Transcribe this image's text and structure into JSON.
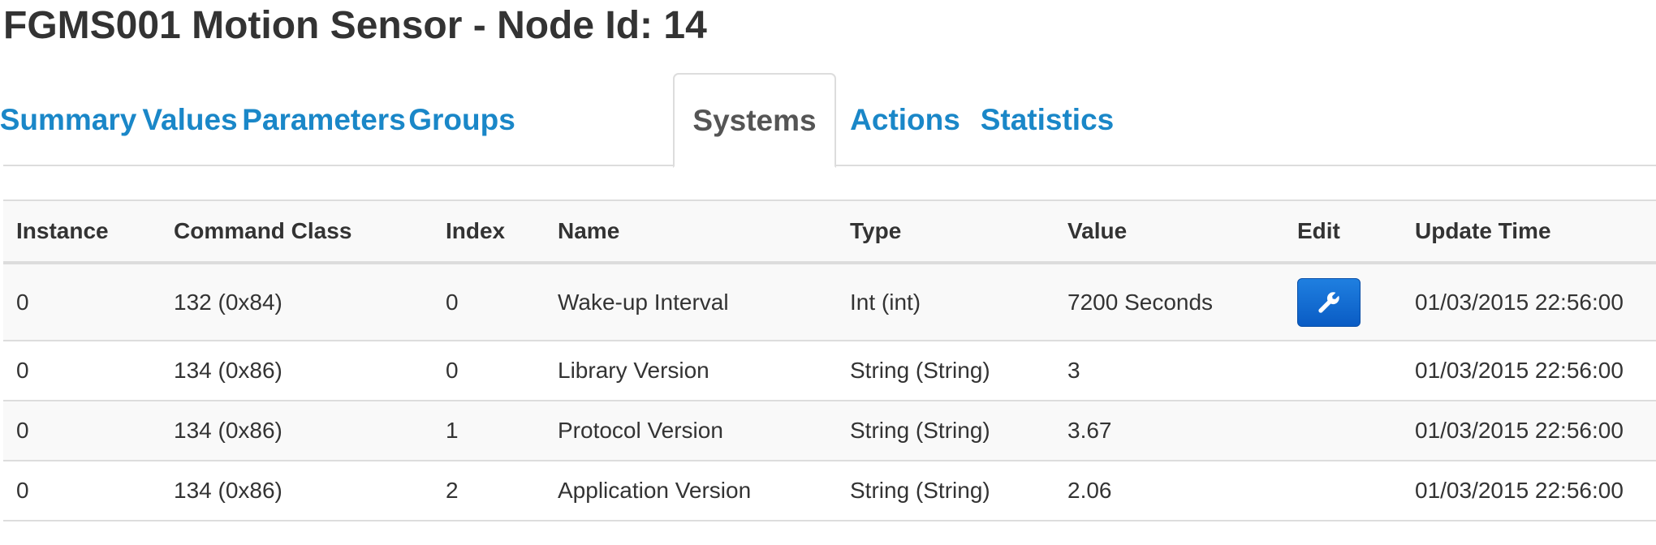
{
  "page": {
    "title": "FGMS001 Motion Sensor - Node Id: 14"
  },
  "tabs": [
    {
      "label": "Summary",
      "active": false
    },
    {
      "label": "Values",
      "active": false
    },
    {
      "label": "Parameters",
      "active": false
    },
    {
      "label": "Groups",
      "active": false
    },
    {
      "label": "Systems",
      "active": true
    },
    {
      "label": "Actions",
      "active": false
    },
    {
      "label": "Statistics",
      "active": false
    }
  ],
  "table": {
    "headers": {
      "instance": "Instance",
      "command_class": "Command Class",
      "index": "Index",
      "name": "Name",
      "type": "Type",
      "value": "Value",
      "edit": "Edit",
      "update_time": "Update Time"
    },
    "rows": [
      {
        "instance": "0",
        "command_class": "132 (0x84)",
        "index": "0",
        "name": "Wake-up Interval",
        "type": "Int (int)",
        "value": "7200 Seconds",
        "editable": true,
        "update_time": "01/03/2015 22:56:00"
      },
      {
        "instance": "0",
        "command_class": "134 (0x86)",
        "index": "0",
        "name": "Library Version",
        "type": "String (String)",
        "value": "3",
        "editable": false,
        "update_time": "01/03/2015 22:56:00"
      },
      {
        "instance": "0",
        "command_class": "134 (0x86)",
        "index": "1",
        "name": "Protocol Version",
        "type": "String (String)",
        "value": "3.67",
        "editable": false,
        "update_time": "01/03/2015 22:56:00"
      },
      {
        "instance": "0",
        "command_class": "134 (0x86)",
        "index": "2",
        "name": "Application Version",
        "type": "String (String)",
        "value": "2.06",
        "editable": false,
        "update_time": "01/03/2015 22:56:00"
      }
    ]
  },
  "icons": {
    "edit": "wrench-icon"
  },
  "colors": {
    "link": "#1a87c8",
    "active_tab": "#555555",
    "edit_button": "#0a5cc4",
    "border": "#dddddd",
    "stripe": "#f9f9f9"
  }
}
